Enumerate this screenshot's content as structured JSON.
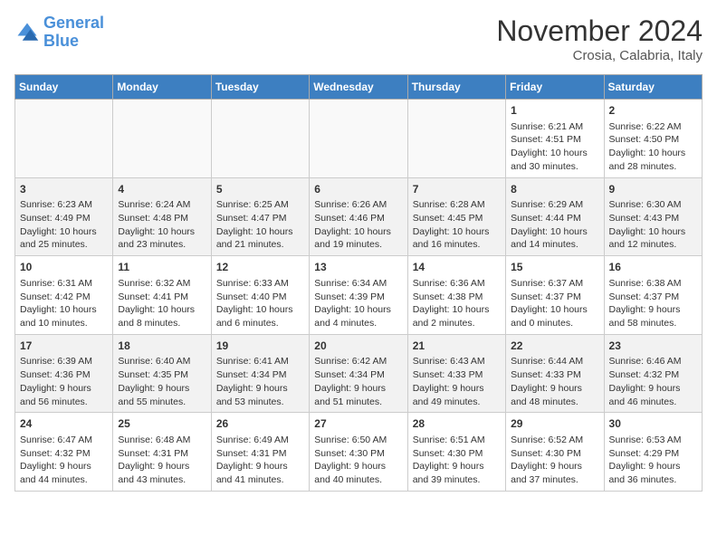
{
  "logo": {
    "text_general": "General",
    "text_blue": "Blue"
  },
  "title": "November 2024",
  "location": "Crosia, Calabria, Italy",
  "weekdays": [
    "Sunday",
    "Monday",
    "Tuesday",
    "Wednesday",
    "Thursday",
    "Friday",
    "Saturday"
  ],
  "weeks": [
    [
      {
        "day": "",
        "info": ""
      },
      {
        "day": "",
        "info": ""
      },
      {
        "day": "",
        "info": ""
      },
      {
        "day": "",
        "info": ""
      },
      {
        "day": "",
        "info": ""
      },
      {
        "day": "1",
        "info": "Sunrise: 6:21 AM\nSunset: 4:51 PM\nDaylight: 10 hours\nand 30 minutes."
      },
      {
        "day": "2",
        "info": "Sunrise: 6:22 AM\nSunset: 4:50 PM\nDaylight: 10 hours\nand 28 minutes."
      }
    ],
    [
      {
        "day": "3",
        "info": "Sunrise: 6:23 AM\nSunset: 4:49 PM\nDaylight: 10 hours\nand 25 minutes."
      },
      {
        "day": "4",
        "info": "Sunrise: 6:24 AM\nSunset: 4:48 PM\nDaylight: 10 hours\nand 23 minutes."
      },
      {
        "day": "5",
        "info": "Sunrise: 6:25 AM\nSunset: 4:47 PM\nDaylight: 10 hours\nand 21 minutes."
      },
      {
        "day": "6",
        "info": "Sunrise: 6:26 AM\nSunset: 4:46 PM\nDaylight: 10 hours\nand 19 minutes."
      },
      {
        "day": "7",
        "info": "Sunrise: 6:28 AM\nSunset: 4:45 PM\nDaylight: 10 hours\nand 16 minutes."
      },
      {
        "day": "8",
        "info": "Sunrise: 6:29 AM\nSunset: 4:44 PM\nDaylight: 10 hours\nand 14 minutes."
      },
      {
        "day": "9",
        "info": "Sunrise: 6:30 AM\nSunset: 4:43 PM\nDaylight: 10 hours\nand 12 minutes."
      }
    ],
    [
      {
        "day": "10",
        "info": "Sunrise: 6:31 AM\nSunset: 4:42 PM\nDaylight: 10 hours\nand 10 minutes."
      },
      {
        "day": "11",
        "info": "Sunrise: 6:32 AM\nSunset: 4:41 PM\nDaylight: 10 hours\nand 8 minutes."
      },
      {
        "day": "12",
        "info": "Sunrise: 6:33 AM\nSunset: 4:40 PM\nDaylight: 10 hours\nand 6 minutes."
      },
      {
        "day": "13",
        "info": "Sunrise: 6:34 AM\nSunset: 4:39 PM\nDaylight: 10 hours\nand 4 minutes."
      },
      {
        "day": "14",
        "info": "Sunrise: 6:36 AM\nSunset: 4:38 PM\nDaylight: 10 hours\nand 2 minutes."
      },
      {
        "day": "15",
        "info": "Sunrise: 6:37 AM\nSunset: 4:37 PM\nDaylight: 10 hours\nand 0 minutes."
      },
      {
        "day": "16",
        "info": "Sunrise: 6:38 AM\nSunset: 4:37 PM\nDaylight: 9 hours\nand 58 minutes."
      }
    ],
    [
      {
        "day": "17",
        "info": "Sunrise: 6:39 AM\nSunset: 4:36 PM\nDaylight: 9 hours\nand 56 minutes."
      },
      {
        "day": "18",
        "info": "Sunrise: 6:40 AM\nSunset: 4:35 PM\nDaylight: 9 hours\nand 55 minutes."
      },
      {
        "day": "19",
        "info": "Sunrise: 6:41 AM\nSunset: 4:34 PM\nDaylight: 9 hours\nand 53 minutes."
      },
      {
        "day": "20",
        "info": "Sunrise: 6:42 AM\nSunset: 4:34 PM\nDaylight: 9 hours\nand 51 minutes."
      },
      {
        "day": "21",
        "info": "Sunrise: 6:43 AM\nSunset: 4:33 PM\nDaylight: 9 hours\nand 49 minutes."
      },
      {
        "day": "22",
        "info": "Sunrise: 6:44 AM\nSunset: 4:33 PM\nDaylight: 9 hours\nand 48 minutes."
      },
      {
        "day": "23",
        "info": "Sunrise: 6:46 AM\nSunset: 4:32 PM\nDaylight: 9 hours\nand 46 minutes."
      }
    ],
    [
      {
        "day": "24",
        "info": "Sunrise: 6:47 AM\nSunset: 4:32 PM\nDaylight: 9 hours\nand 44 minutes."
      },
      {
        "day": "25",
        "info": "Sunrise: 6:48 AM\nSunset: 4:31 PM\nDaylight: 9 hours\nand 43 minutes."
      },
      {
        "day": "26",
        "info": "Sunrise: 6:49 AM\nSunset: 4:31 PM\nDaylight: 9 hours\nand 41 minutes."
      },
      {
        "day": "27",
        "info": "Sunrise: 6:50 AM\nSunset: 4:30 PM\nDaylight: 9 hours\nand 40 minutes."
      },
      {
        "day": "28",
        "info": "Sunrise: 6:51 AM\nSunset: 4:30 PM\nDaylight: 9 hours\nand 39 minutes."
      },
      {
        "day": "29",
        "info": "Sunrise: 6:52 AM\nSunset: 4:30 PM\nDaylight: 9 hours\nand 37 minutes."
      },
      {
        "day": "30",
        "info": "Sunrise: 6:53 AM\nSunset: 4:29 PM\nDaylight: 9 hours\nand 36 minutes."
      }
    ]
  ]
}
